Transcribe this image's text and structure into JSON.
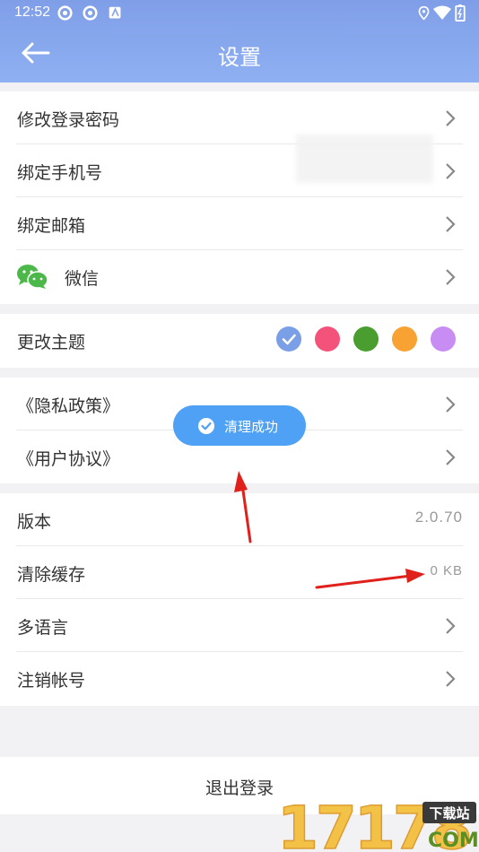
{
  "status_bar": {
    "time": "12:52"
  },
  "header": {
    "title": "设置",
    "back_icon": "back-arrow-icon"
  },
  "account_section": [
    {
      "label": "修改登录密码"
    },
    {
      "label": "绑定手机号"
    },
    {
      "label": "绑定邮箱"
    },
    {
      "label": "微信",
      "icon": "wechat-icon"
    }
  ],
  "theme_section": {
    "label": "更改主题",
    "colors": [
      "#7b9fe6",
      "#f3527a",
      "#4a9e2f",
      "#f7a233",
      "#c88df2"
    ],
    "selected_index": 0
  },
  "policy_section": [
    {
      "label": "《隐私政策》"
    },
    {
      "label": "《用户协议》"
    }
  ],
  "toast": {
    "text": "清理成功",
    "icon": "check-circle-icon"
  },
  "app_section": {
    "version_label": "版本",
    "version_value": "2.0.70",
    "cache_label": "清除缓存",
    "cache_value": "0 KB",
    "language_label": "多语言",
    "delete_account_label": "注销帐号"
  },
  "logout_label": "退出登录",
  "watermark": {
    "number": "17178",
    "tag": "下载站",
    "domain": "COM"
  },
  "colors": {
    "header": "#8aa8ee",
    "toast": "#4ea1f5",
    "annotation": "#e0201a"
  }
}
